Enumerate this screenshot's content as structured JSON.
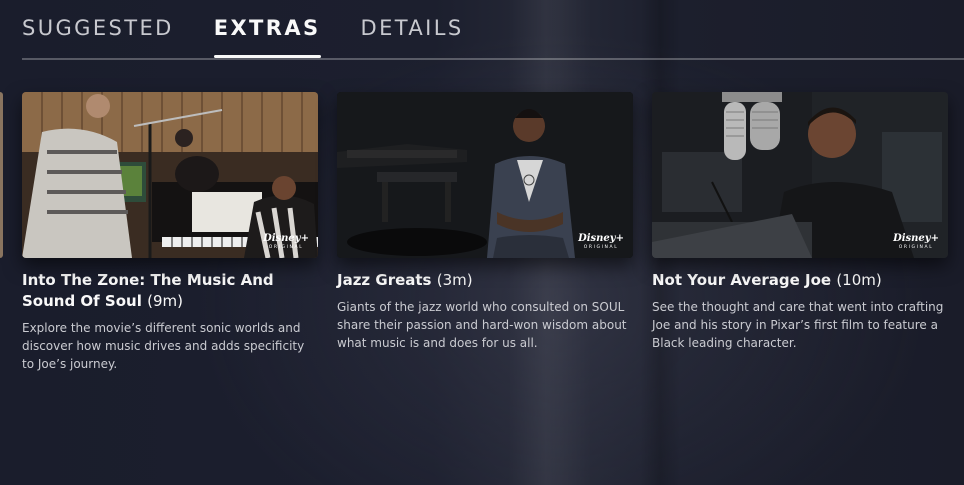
{
  "tabs": [
    {
      "label": "SUGGESTED",
      "active": false
    },
    {
      "label": "EXTRAS",
      "active": true
    },
    {
      "label": "DETAILS",
      "active": false
    }
  ],
  "badge": {
    "logo": "Disney+",
    "subtitle": "ORIGINAL"
  },
  "cards": [
    {
      "title": "Into The Zone: The Music And Sound Of Soul",
      "duration": "(9m)",
      "description": "Explore the movie’s different sonic worlds and discover how music drives and adds specificity to Joe’s journey."
    },
    {
      "title": "Jazz Greats",
      "duration": "(3m)",
      "description": "Giants of the jazz world who consulted on SOUL share their passion and hard-won wisdom about what music is and does for us all."
    },
    {
      "title": "Not Your Average Joe",
      "duration": "(10m)",
      "description": "See the thought and care that went into crafting Joe and his story in Pixar’s first film to feature a Black leading character."
    }
  ]
}
